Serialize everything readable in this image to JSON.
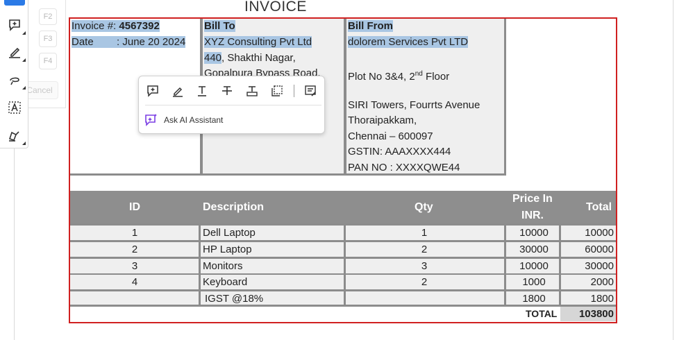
{
  "document": {
    "title": "INVOICE",
    "invoice_label": "Invoice #:",
    "invoice_number": "4567392",
    "date_label": "Date",
    "date_value": ": June 20 2024",
    "bill_to": {
      "heading": "Bill To",
      "company": "XYZ Consulting Pvt Ltd",
      "address_num": "440",
      "address_rest": ",  Shakthi Nagar,",
      "address_line2": "Gopalpura Bypass Road,"
    },
    "bill_from": {
      "heading": "Bill From",
      "company": "dolorem Services Pvt LTD",
      "line_plot_pre": "Plot No 3&4, 2",
      "line_plot_sup": "nd",
      "line_plot_post": " Floor",
      "line_towers": "SIRI Towers, Fourrts Avenue",
      "line_area": "Thoraipakkam,",
      "line_city": "Chennai – 600097",
      "line_gstin": "GSTIN: AAAXXXX444",
      "line_pan": "PAN NO : XXXXQWE44"
    },
    "table": {
      "headers": {
        "id": "ID",
        "description": "Description",
        "qty": "Qty",
        "price_line1": "Price In",
        "price_line2": "INR.",
        "total": "Total"
      },
      "rows": [
        {
          "id": "1",
          "description": " Dell Laptop",
          "qty": "1",
          "price": "10000",
          "total": "10000"
        },
        {
          "id": "2",
          "description": "HP Laptop",
          "qty": "2",
          "price": "30000",
          "total": "60000"
        },
        {
          "id": "3",
          "description": "Monitors",
          "qty": "3",
          "price": "10000",
          "total": "30000"
        },
        {
          "id": "4",
          "description": "Keyboard",
          "qty": "2",
          "price": "1000",
          "total": "2000"
        },
        {
          "id": "",
          "description": "  IGST @18%",
          "qty": "",
          "price": "1800",
          "total": "1800"
        }
      ],
      "total_label": "TOTAL",
      "total_value": "103800"
    }
  },
  "hint_panel": {
    "keys": [
      "F2",
      "F3",
      "F4"
    ],
    "cancel_label": "Cancel"
  },
  "toolbar": {
    "tools": [
      "select-tool-icon",
      "add-comment-icon",
      "highlight-icon",
      "draw-freeform-icon",
      "text-box-icon",
      "sign-icon"
    ]
  },
  "popup": {
    "tools": [
      "add-comment-icon",
      "highlight-icon",
      "underline-icon",
      "strikethrough-icon",
      "replace-text-icon",
      "copy-icon",
      "add-note-icon"
    ],
    "ai_label": "Ask AI Assistant"
  },
  "colors": {
    "accent": "#2b7ae6",
    "selection_highlight": "#a9c6e3",
    "frame_red": "#d02020",
    "table_header": "#8e8e8e"
  }
}
